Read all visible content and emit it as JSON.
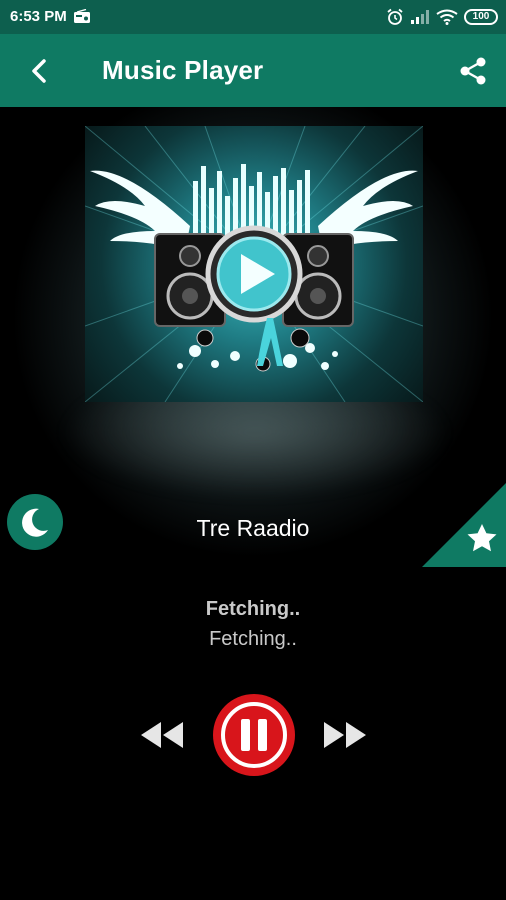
{
  "status_bar": {
    "time": "6:53 PM",
    "left_icon": "radio-icon",
    "right_icons": [
      "alarm-icon",
      "signal-icon",
      "wifi-icon"
    ],
    "battery_level": "100"
  },
  "app_bar": {
    "title": "Music Player",
    "back_icon": "back-arrow-icon",
    "share_icon": "share-icon"
  },
  "station": {
    "name": "Tre Raadio"
  },
  "track": {
    "title": "Fetching..",
    "artist": "Fetching.."
  },
  "controls": {
    "rewind_icon": "rewind-icon",
    "pause_icon": "pause-icon",
    "forward_icon": "fast-forward-icon",
    "sleep_icon": "moon-icon",
    "favorite_icon": "star-icon"
  },
  "colors": {
    "status_bar": "#0d5f4e",
    "app_bar": "#0f7a63",
    "accent": "#0f7a63",
    "pause_button": "#d8151b",
    "background": "#000000",
    "secondary_text": "#c9c9c9"
  }
}
